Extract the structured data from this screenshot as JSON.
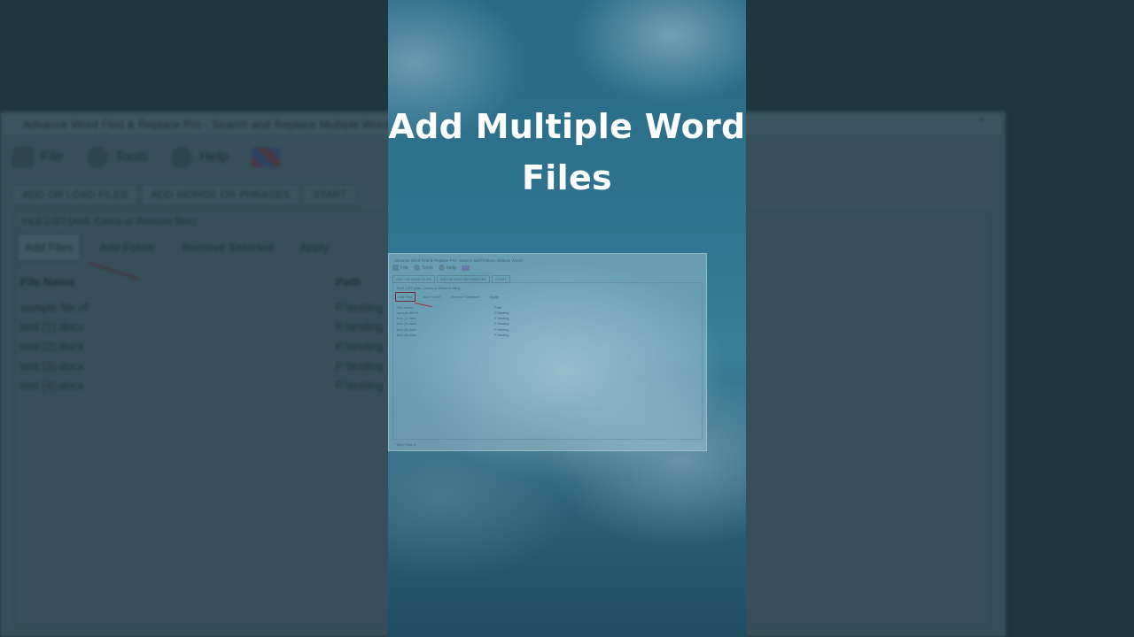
{
  "headline": {
    "line1": "Add Multiple Word",
    "line2": "Files"
  },
  "app": {
    "title": "Advance Word Find & Replace Pro - Search and Replace Multiple Words",
    "close_glyph": "×",
    "menu": [
      {
        "label": "File",
        "icon": "file-icon"
      },
      {
        "label": "Tools",
        "icon": "tools-icon"
      },
      {
        "label": "Help",
        "icon": "help-icon"
      }
    ],
    "tabs": [
      "ADD OR LOAD FILES",
      "ADD WORDS OR PHRASES",
      "START"
    ],
    "group_label": "FILE LIST (Add, Check or Remove files)",
    "toolbar": [
      "Add Files",
      "Add Folder",
      "Remove Selected",
      "Apply"
    ],
    "columns": {
      "name": "File Name",
      "path": "Path"
    },
    "files": [
      {
        "name": "sample file.rtf",
        "path": "F:\\testing"
      },
      {
        "name": "test (1).docx",
        "path": "F:\\testing"
      },
      {
        "name": "test (2).docx",
        "path": "F:\\testing"
      },
      {
        "name": "test (3).docx",
        "path": "F:\\testing"
      },
      {
        "name": "test (4).docx",
        "path": "F:\\testing"
      }
    ],
    "status": "Total Files: 5"
  },
  "colors": {
    "panel_top": "#2a6a86",
    "panel_bottom": "#1f4c60",
    "backdrop": "#1e3640",
    "headline": "#ffffff",
    "arrow": "#a0303c"
  }
}
